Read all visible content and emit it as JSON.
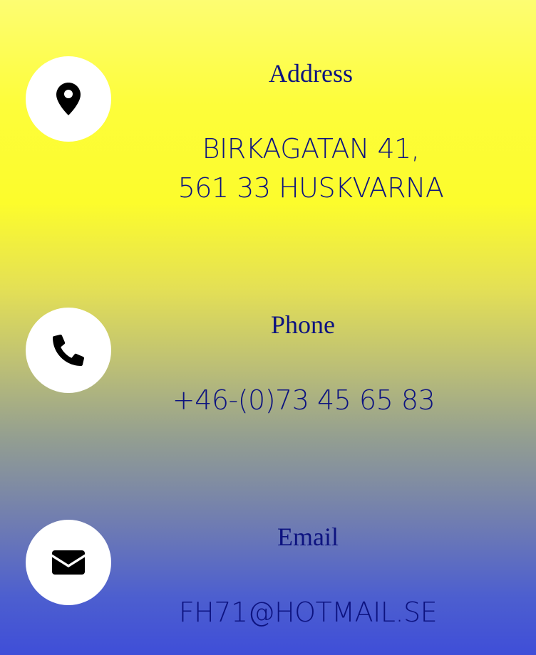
{
  "address": {
    "icon": "map-marker-icon",
    "heading": "Address",
    "line1": "BIRKAGATAN 41,",
    "line2": "561 33 HUSKVARNA"
  },
  "phone": {
    "icon": "phone-icon",
    "heading": "Phone",
    "value": "+46-(0)73 45 65 83"
  },
  "email": {
    "icon": "envelope-icon",
    "heading": "Email",
    "value": "FH71@HOTMAIL.SE"
  },
  "colors": {
    "text": "#0d1380",
    "icon_bg": "#ffffff",
    "icon_fg": "#000000",
    "gradient_top": "#fdfd72",
    "gradient_mid": "#fcfc2c",
    "gradient_bottom": "#3f4ed8"
  }
}
